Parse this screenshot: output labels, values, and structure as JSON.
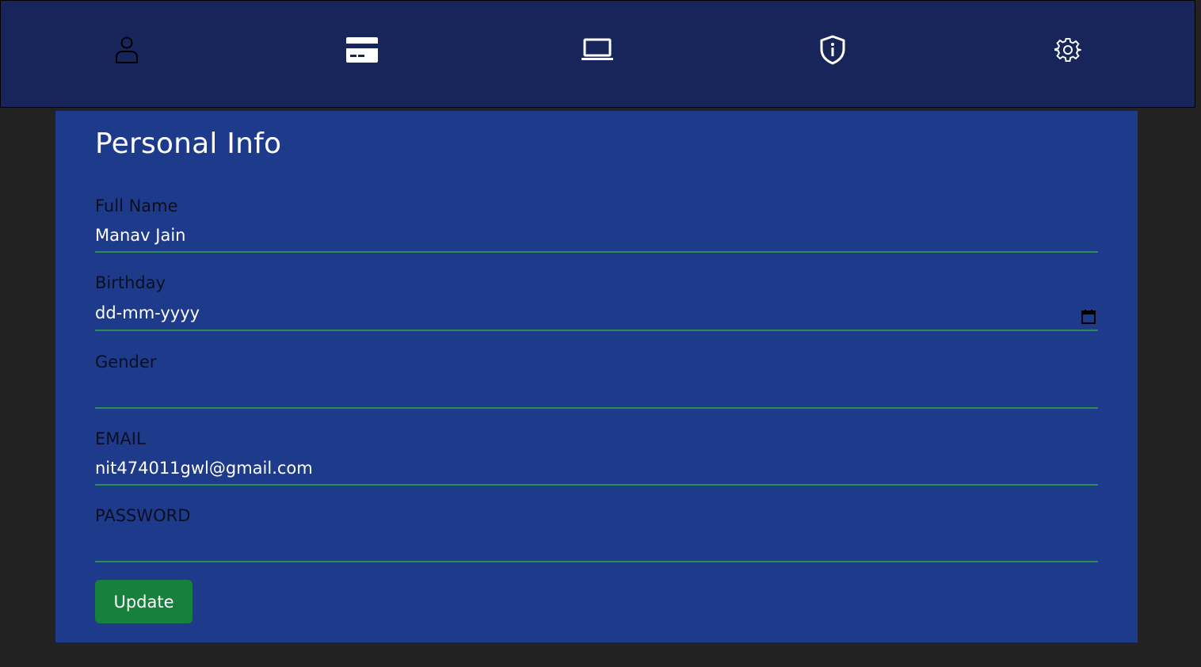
{
  "nav": {
    "items": [
      {
        "icon": "user-icon"
      },
      {
        "icon": "credit-card-icon"
      },
      {
        "icon": "laptop-icon"
      },
      {
        "icon": "shield-info-icon"
      },
      {
        "icon": "gear-icon"
      }
    ]
  },
  "form": {
    "title": "Personal Info",
    "full_name": {
      "label": "Full Name",
      "value": "Manav Jain"
    },
    "birthday": {
      "label": "Birthday",
      "value": "dd-mm-yyyy"
    },
    "gender": {
      "label": "Gender",
      "value": ""
    },
    "email": {
      "label": "EMAIL",
      "value": "nit474011gwl@gmail.com"
    },
    "password": {
      "label": "PASSWORD",
      "value": ""
    },
    "submit_label": "Update"
  },
  "colors": {
    "nav_bg": "#18255a",
    "panel_bg": "#1e3a8a",
    "page_bg": "#222222",
    "underline": "#2e8b57",
    "button": "#16803c"
  }
}
